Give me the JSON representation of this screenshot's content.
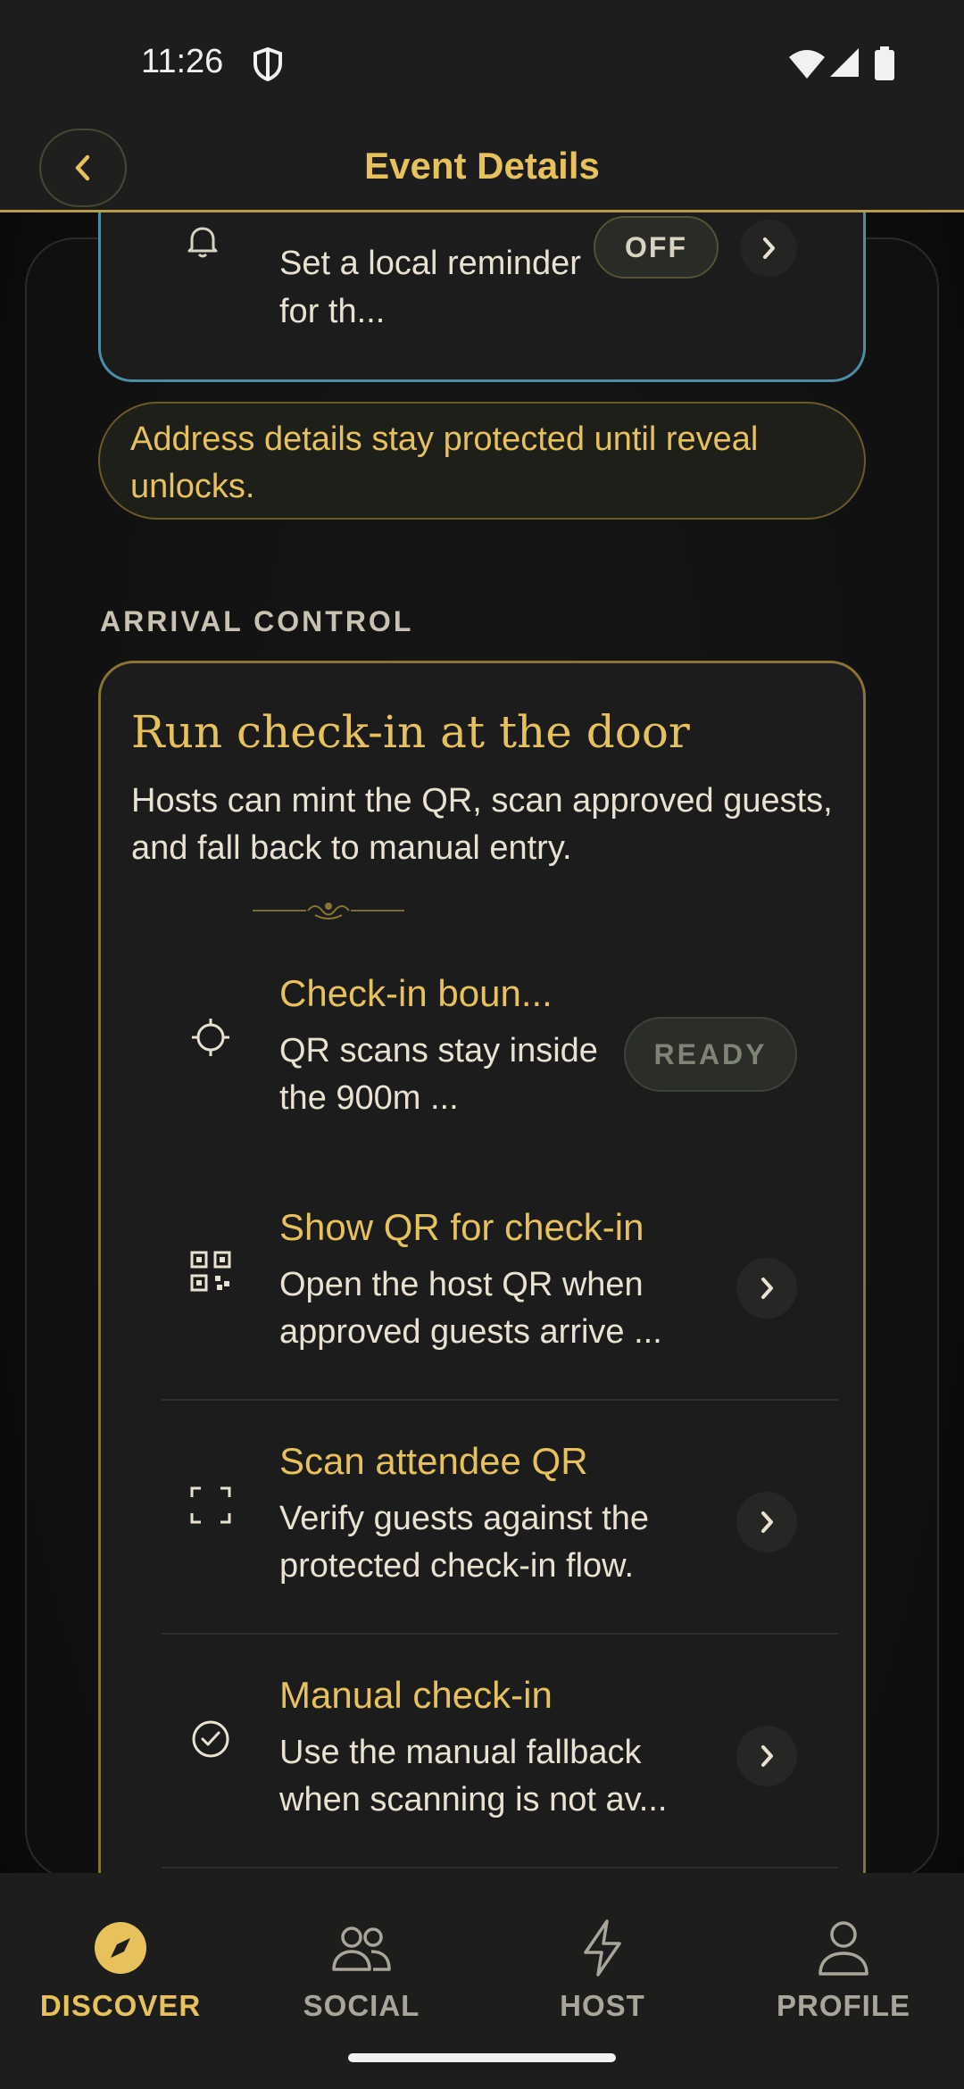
{
  "status_bar": {
    "time": "11:26",
    "icons": [
      "shield-icon",
      "wifi-icon",
      "signal-icon",
      "battery-icon"
    ]
  },
  "header": {
    "title": "Event Details",
    "back_icon": "chevron-left-icon"
  },
  "reminder": {
    "text": "Set a local reminder for th...",
    "toggle_label": "OFF",
    "icon": "bell-icon"
  },
  "notice": {
    "text": "Address details stay protected until reveal unlocks."
  },
  "arrival": {
    "section_label": "ARRIVAL CONTROL",
    "title": "Run check-in at the door",
    "subtitle": "Hosts can mint the QR, scan approved guests, and fall back to manual entry.",
    "rows": [
      {
        "icon": "crosshair-icon",
        "title": "Check-in boun...",
        "desc": "QR scans stay inside the 900m ...",
        "status": "READY"
      },
      {
        "icon": "qr-code-icon",
        "title": "Show QR for check-in",
        "desc": "Open the host QR when approved guests arrive ..."
      },
      {
        "icon": "scan-frame-icon",
        "title": "Scan attendee QR",
        "desc": "Verify guests against the protected check-in flow."
      },
      {
        "icon": "check-circle-icon",
        "title": "Manual check-in",
        "desc": "Use the manual fallback when scanning is not av..."
      }
    ]
  },
  "nav": {
    "items": [
      {
        "label": "DISCOVER",
        "icon": "compass-icon",
        "active": true
      },
      {
        "label": "SOCIAL",
        "icon": "people-icon",
        "active": false
      },
      {
        "label": "HOST",
        "icon": "lightning-icon",
        "active": false
      },
      {
        "label": "PROFILE",
        "icon": "person-icon",
        "active": false
      }
    ]
  },
  "colors": {
    "accent_gold": "#e6c15c",
    "reminder_border": "#4b8ea8",
    "card_border": "#8a7434",
    "background": "#101010"
  }
}
